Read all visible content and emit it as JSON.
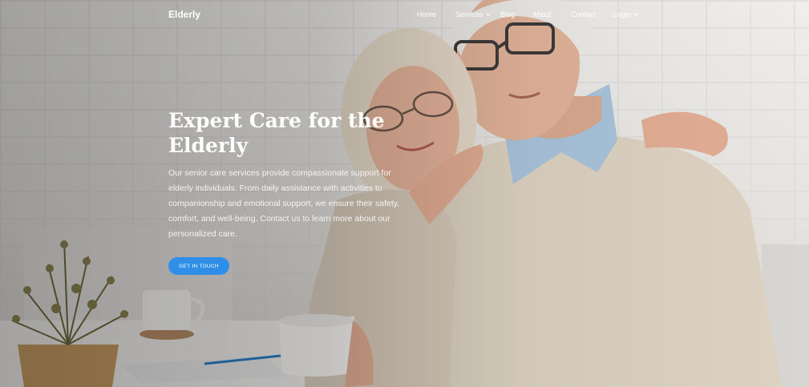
{
  "nav": {
    "brand": "Elderly",
    "links": [
      {
        "label": "Home"
      },
      {
        "label": "Services",
        "dropdown": true
      },
      {
        "label": "Blog"
      },
      {
        "label": "About"
      },
      {
        "label": "Contact"
      },
      {
        "label": "Login",
        "dropdown": true
      }
    ]
  },
  "hero": {
    "title": "Expert Care for the Elderly",
    "description": "Our senior care services provide compassionate support for elderly individuals. From daily assistance with activities to companionship and emotional support, we ensure their safety, comfort, and well-being. Contact us to learn more about our personalized care.",
    "cta_label": "GET IN TOUCH"
  },
  "colors": {
    "accent": "#2f8ee8",
    "text_light": "#ffffff",
    "sweater": "#ded3c2",
    "shirt": "#a9c4dc",
    "hair": "#e8dccb"
  },
  "icons": {
    "dropdown": "chevron-down-icon"
  }
}
